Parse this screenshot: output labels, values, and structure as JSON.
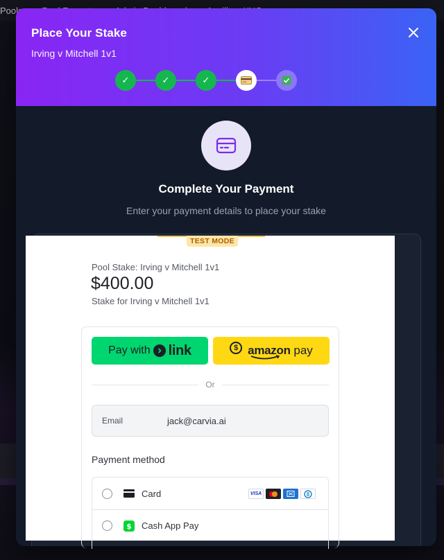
{
  "background_nav": {
    "items": [
      "Pools",
      "Pool Formats",
      "Admin Dashboard",
      "Ancillary KYC"
    ]
  },
  "modal": {
    "title": "Place Your Stake",
    "subtitle": "Irving v Mitchell 1v1",
    "close_icon": "close-icon",
    "steps": [
      {
        "state": "done",
        "icon": "check-icon",
        "glyph": "✓"
      },
      {
        "state": "done",
        "icon": "check-icon",
        "glyph": "✓"
      },
      {
        "state": "done",
        "icon": "check-icon",
        "glyph": "✓"
      },
      {
        "state": "current",
        "icon": "credit-card-icon"
      },
      {
        "state": "future",
        "icon": "checkbox-icon"
      }
    ],
    "heading": "Complete Your Payment",
    "description": "Enter your payment details to place your stake"
  },
  "checkout": {
    "test_mode": "TEST MODE",
    "pool_label": "Pool Stake: Irving v Mitchell 1v1",
    "amount": "$400.00",
    "stake_desc": "Stake for Irving v Mitchell 1v1",
    "link_button": {
      "prefix": "Pay with",
      "brand": "link"
    },
    "amazon_button": {
      "brand_a": "amazon",
      "brand_b": " pay"
    },
    "or_label": "Or",
    "email": {
      "label": "Email",
      "value": "jack@carvia.ai"
    },
    "payment_method_title": "Payment method",
    "methods": [
      {
        "label": "Card",
        "icon": "card-icon"
      },
      {
        "label": "Cash App Pay",
        "icon": "cash-app-icon"
      }
    ],
    "card_brands": [
      "VISA",
      "mastercard",
      "AMEX",
      "diners"
    ]
  },
  "colors": {
    "header_start": "#8a25f4",
    "header_end": "#3a63f5",
    "step_done": "#16b64f",
    "link_green": "#00d66f",
    "amazon_yellow": "#ffd814",
    "modal_bg": "#131a29"
  }
}
